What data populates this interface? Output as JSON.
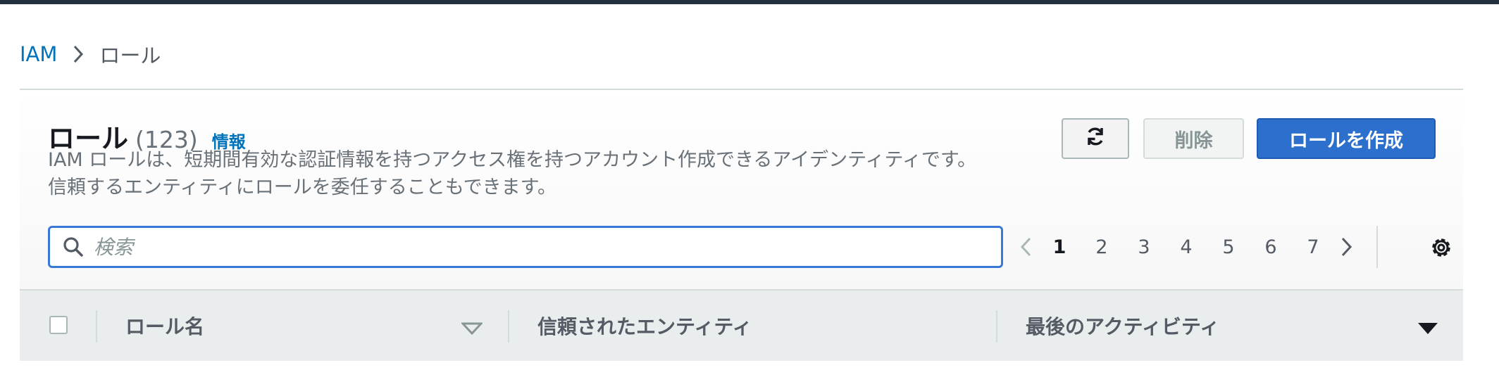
{
  "breadcrumb": {
    "root": "IAM",
    "current": "ロール"
  },
  "header": {
    "title": "ロール",
    "count": "(123)",
    "info_link": "情報",
    "description": "IAM ロールは、短期間有効な認証情報を持つアクセス権を持つアカウント作成できるアイデンティティです。信頼するエンティティにロールを委任することもできます。"
  },
  "actions": {
    "refresh_icon": "refresh-icon",
    "delete_label": "削除",
    "create_label": "ロールを作成"
  },
  "search": {
    "placeholder": "検索",
    "value": ""
  },
  "pagination": {
    "current_page": 1,
    "pages": [
      "1",
      "2",
      "3",
      "4",
      "5",
      "6",
      "7"
    ]
  },
  "table": {
    "columns": [
      {
        "label": "ロール名",
        "sort": "unsorted"
      },
      {
        "label": "信頼されたエンティティ"
      },
      {
        "label": "最後のアクティビティ",
        "sort": "descending"
      }
    ]
  },
  "colors": {
    "topbar": "#232f3e",
    "link": "#0073bb",
    "primary_button": "#2c6fcc",
    "focus_border": "#3a78d6"
  }
}
